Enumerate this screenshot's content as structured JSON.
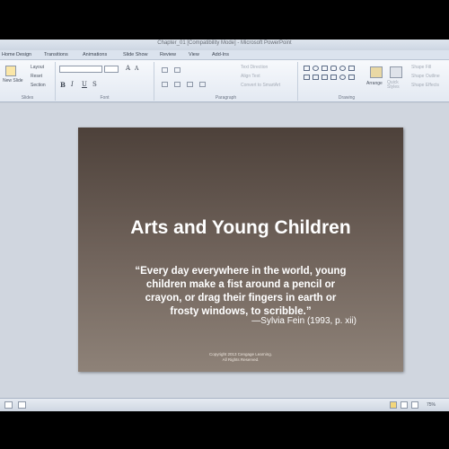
{
  "window": {
    "title": "Chapter_01 [Compatibility Mode] - Microsoft PowerPoint"
  },
  "tabs": [
    "Home",
    "Design",
    "Transitions",
    "Animations",
    "Slide Show",
    "Review",
    "View",
    "Add-Ins"
  ],
  "ribbon": {
    "slides": {
      "new_slide": "New Slide",
      "layout": "Layout",
      "reset": "Reset",
      "section": "Section",
      "label": "Slides"
    },
    "font": {
      "label": "Font",
      "font_size": "",
      "bold": "B",
      "italic": "I",
      "underline": "U",
      "strike": "S",
      "grow": "A",
      "shrink": "A"
    },
    "paragraph": {
      "label": "Paragraph",
      "text_direction": "Text Direction",
      "align_text": "Align Text",
      "convert_smartart": "Convert to SmartArt"
    },
    "drawing": {
      "label": "Drawing",
      "arrange": "Arrange",
      "quick_styles": "Quick Styles",
      "shape_fill": "Shape Fill",
      "shape_outline": "Shape Outline",
      "shape_effects": "Shape Effects"
    }
  },
  "slide": {
    "title": "Arts and Young Children",
    "quote_lines": [
      "“Every day everywhere in the world, young",
      "children make a fist around a pencil or",
      "crayon, or drag their fingers in earth or",
      "frosty windows, to scribble.”"
    ],
    "attribution": "—Sylvia Fein (1993, p. xii)",
    "copyright_lines": [
      "Copyright 2013 Cengage Learning.",
      "All Rights Reserved."
    ]
  },
  "status": {
    "zoom": "75%"
  },
  "colors": {
    "slide_top": "#4d413a",
    "slide_bottom": "#8e8278",
    "ribbon": "#e3e9f2"
  }
}
